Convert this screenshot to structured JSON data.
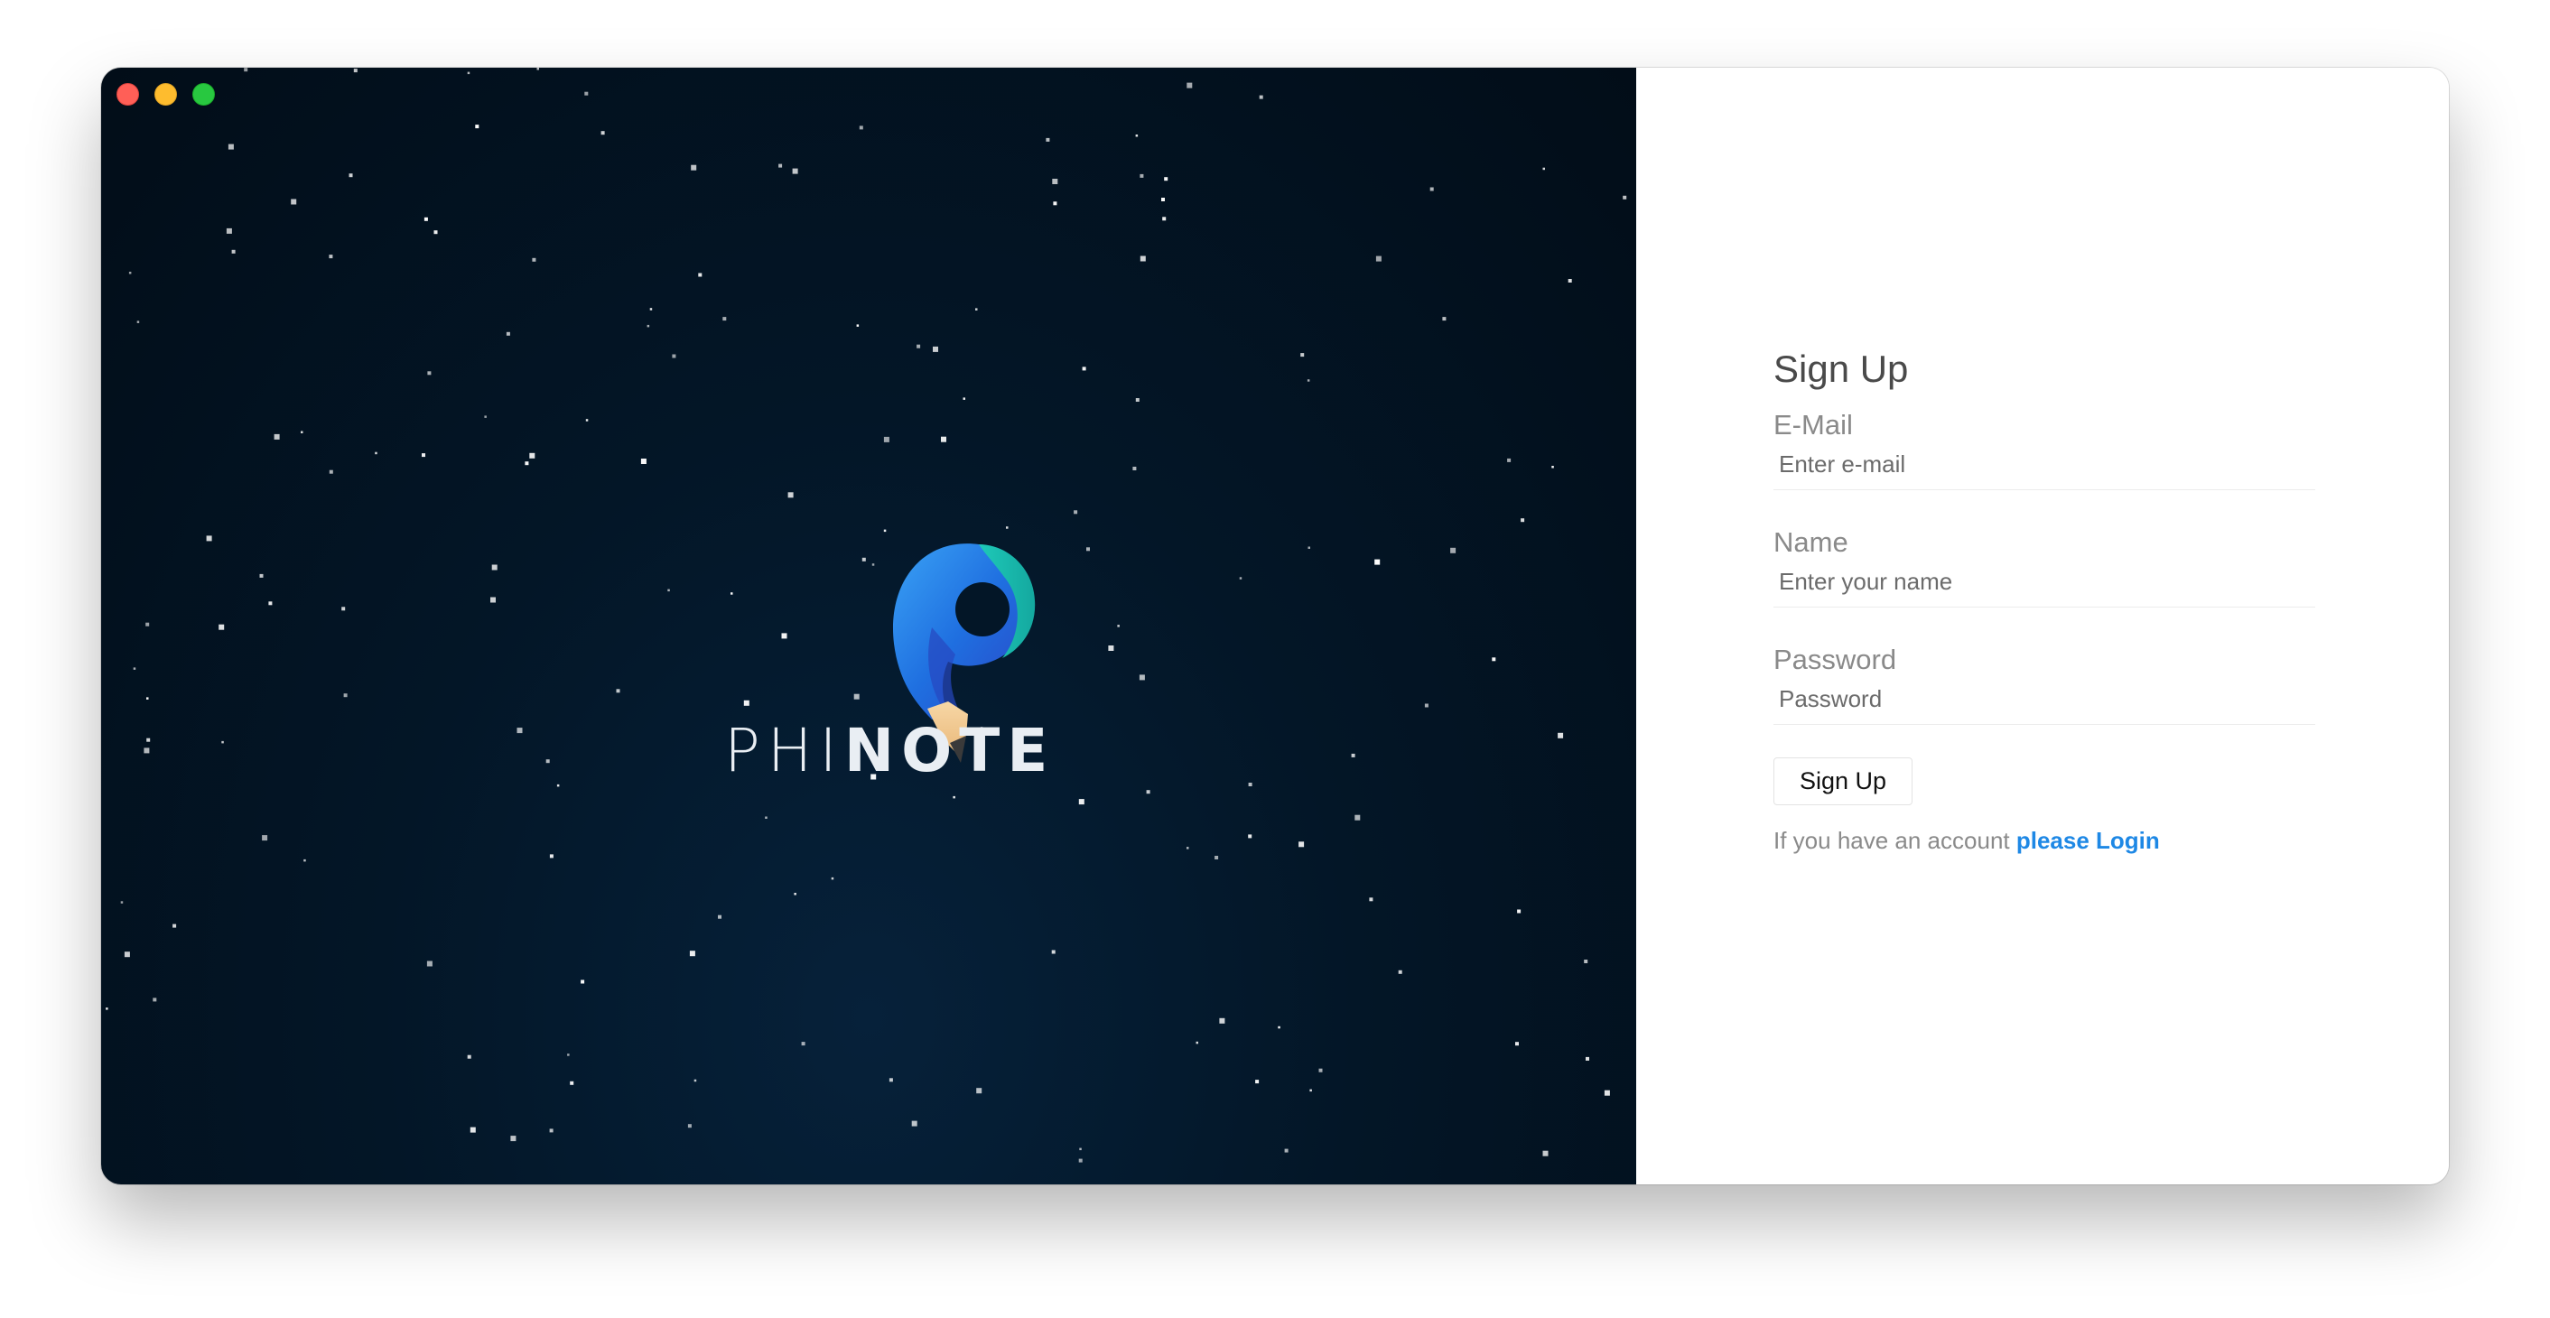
{
  "app": {
    "brand_light": "PHI",
    "brand_bold": "NOTE",
    "logo_icon": "phinote-pencil-logo-icon"
  },
  "window_controls": {
    "close_color": "#ff5f57",
    "minimize_color": "#febc2e",
    "maximize_color": "#28c840"
  },
  "form": {
    "title": "Sign Up",
    "email": {
      "label": "E-Mail",
      "placeholder": "Enter e-mail"
    },
    "name": {
      "label": "Name",
      "placeholder": "Enter your name"
    },
    "password": {
      "label": "Password",
      "placeholder": "Password"
    },
    "submit_label": "Sign Up",
    "login_prompt": "If you have an account",
    "login_link": "please Login"
  },
  "colors": {
    "hero_background": "#031627",
    "link_accent": "#1e88e5"
  }
}
